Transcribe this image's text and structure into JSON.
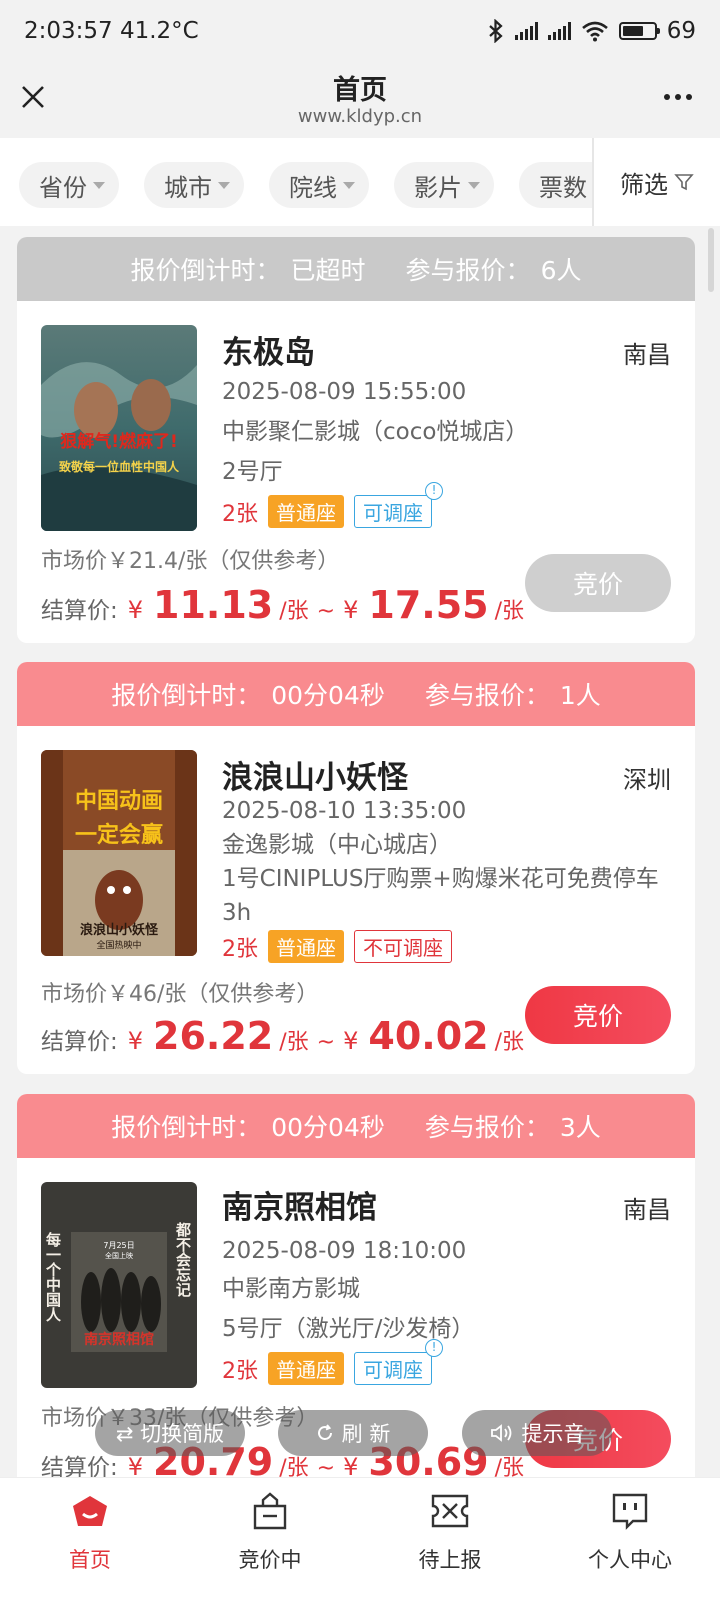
{
  "status_bar": {
    "time_temp": "2:03:57 41.2°C",
    "battery": "69"
  },
  "title_bar": {
    "title": "首页",
    "url": "www.kldyp.cn"
  },
  "filters": {
    "chips": [
      "省份",
      "城市",
      "院线",
      "影片",
      "票数"
    ],
    "filter_label": "筛选"
  },
  "cards": [
    {
      "countdown_label": "报价倒计时：",
      "countdown_value": "已超时",
      "participants_label": "参与报价：",
      "participants_value": "6人",
      "title": "东极岛",
      "city": "南昌",
      "datetime": "2025-08-09 15:55:00",
      "cinema": "中影聚仁影城（coco悦城店）",
      "hall": "2号厅",
      "count": "2张",
      "seat_tag": "普通座",
      "adjust_tag": "可调座",
      "poster_text_1": "狠解气!燃麻了!",
      "poster_text_2": "致敬每一位血性中国人",
      "market_price": "市场价￥21.4/张（仅供参考）",
      "settle_label": "结算价:",
      "currency": "¥",
      "price_low": "11.13",
      "unit": "/张",
      "sep": "~",
      "price_high": "17.55",
      "bid_label": "竞价"
    },
    {
      "countdown_label": "报价倒计时：",
      "countdown_value": "00分04秒",
      "participants_label": "参与报价：",
      "participants_value": "1人",
      "title": "浪浪山小妖怪",
      "city": "深圳",
      "datetime": "2025-08-10 13:35:00",
      "cinema": "金逸影城（中心城店）",
      "hall": "1号CINIPLUS厅购票+购爆米花可免费停车3h",
      "count": "2张",
      "seat_tag": "普通座",
      "adjust_tag": "不可调座",
      "poster_text_1": "中国动画",
      "poster_text_2": "一定会赢",
      "poster_text_3": "浪浪山小妖怪",
      "poster_text_4": "全国热映中",
      "market_price": "市场价￥46/张（仅供参考）",
      "settle_label": "结算价:",
      "currency": "¥",
      "price_low": "26.22",
      "unit": "/张",
      "sep": "~",
      "price_high": "40.02",
      "bid_label": "竞价"
    },
    {
      "countdown_label": "报价倒计时：",
      "countdown_value": "00分04秒",
      "participants_label": "参与报价：",
      "participants_value": "3人",
      "title": "南京照相馆",
      "city": "南昌",
      "datetime": "2025-08-09 18:10:00",
      "cinema": "中影南方影城",
      "hall": "5号厅（激光厅/沙发椅）",
      "count": "2张",
      "seat_tag": "普通座",
      "adjust_tag": "可调座",
      "poster_text_1": "每一个中国人",
      "poster_text_2": "都不会忘记",
      "poster_text_3": "南京照相馆",
      "poster_text_4": "7月25日",
      "poster_text_5": "全国上映",
      "market_price": "市场价￥33/张（仅供参考）",
      "settle_label": "结算价:",
      "currency": "¥",
      "price_low": "20.79",
      "unit": "/张",
      "sep": "~",
      "price_high": "30.69",
      "bid_label": "竞价"
    }
  ],
  "floating": {
    "switch": "⇄ 切换简版",
    "refresh": "刷 新",
    "sound": "提示音"
  },
  "tabs": [
    {
      "label": "首页",
      "icon": "home-icon"
    },
    {
      "label": "竞价中",
      "icon": "bag-icon"
    },
    {
      "label": "待上报",
      "icon": "ticket-icon"
    },
    {
      "label": "个人中心",
      "icon": "profile-icon"
    }
  ],
  "colors": {
    "accent": "#e0353b",
    "pink_header": "#f98b8f",
    "gray_header": "#c9c9c9",
    "seat_tag": "#f7a325",
    "adjust_tag": "#3aa6e0"
  }
}
